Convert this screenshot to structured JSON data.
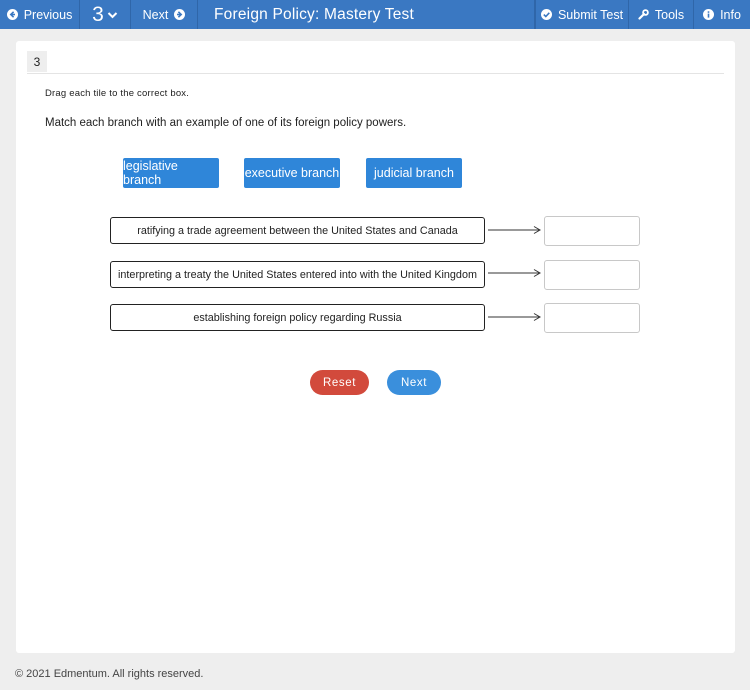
{
  "topbar": {
    "previous_label": "Previous",
    "question_number": "3",
    "next_label": "Next",
    "title": "Foreign Policy: Mastery Test",
    "submit_label": "Submit Test",
    "tools_label": "Tools",
    "info_label": "Info"
  },
  "question": {
    "number": "3",
    "instruction": "Drag each tile to the correct box.",
    "prompt": "Match each branch with an example of one of its foreign policy powers.",
    "tiles": [
      "legislative branch",
      "executive branch",
      "judicial branch"
    ],
    "rows": [
      "ratifying a trade agreement between the United States and Canada",
      "interpreting a treaty the United States entered into with the United Kingdom",
      "establishing foreign policy regarding Russia"
    ]
  },
  "actions": {
    "reset_label": "Reset",
    "next_label": "Next"
  },
  "footer": {
    "copyright": "© 2021 Edmentum. All rights reserved."
  },
  "colors": {
    "topbar": "#3a78c2",
    "tile": "#2f86d9",
    "reset": "#d24a3c",
    "next": "#3a8fdc"
  }
}
